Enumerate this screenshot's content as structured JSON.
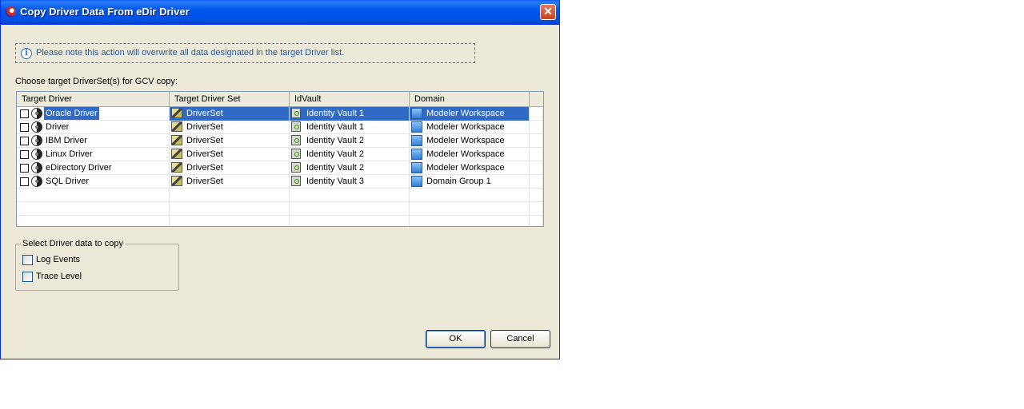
{
  "dialog": {
    "title": "Copy Driver Data From eDir Driver",
    "close_symbol": "✕",
    "notice": "Please note this action will overwrite all data designated in the target Driver list.",
    "info_symbol": "i",
    "choose_label": "Choose target DriverSet(s) for GCV copy:"
  },
  "table": {
    "columns": [
      "Target Driver",
      "Target Driver Set",
      "IdVault",
      "Domain"
    ],
    "rows": [
      {
        "driver": "Oracle Driver",
        "driver_set": "DriverSet",
        "vault": "Identity Vault 1",
        "domain": "Modeler Workspace",
        "selected": true,
        "checked": false
      },
      {
        "driver": "Driver",
        "driver_set": "DriverSet",
        "vault": "Identity Vault 1",
        "domain": "Modeler Workspace",
        "selected": false,
        "checked": false
      },
      {
        "driver": "IBM Driver",
        "driver_set": "DriverSet",
        "vault": "Identity Vault 2",
        "domain": "Modeler Workspace",
        "selected": false,
        "checked": false
      },
      {
        "driver": "Linux Driver",
        "driver_set": "DriverSet",
        "vault": "Identity Vault 2",
        "domain": "Modeler Workspace",
        "selected": false,
        "checked": false
      },
      {
        "driver": "eDirectory Driver",
        "driver_set": "DriverSet",
        "vault": "Identity Vault 2",
        "domain": "Modeler Workspace",
        "selected": false,
        "checked": false
      },
      {
        "driver": "SQL Driver",
        "driver_set": "DriverSet",
        "vault": "Identity Vault 3",
        "domain": "Domain Group 1",
        "selected": false,
        "checked": false
      }
    ]
  },
  "group": {
    "legend": "Select Driver data to copy",
    "options": [
      {
        "label": "Log Events",
        "checked": false
      },
      {
        "label": "Trace Level",
        "checked": false
      }
    ]
  },
  "buttons": {
    "ok": "OK",
    "cancel": "Cancel"
  },
  "colors": {
    "title_bar": "#0058ee",
    "selection": "#316ac5",
    "dialog_bg": "#ece9d8",
    "notice_text": "#2a5a9a"
  }
}
